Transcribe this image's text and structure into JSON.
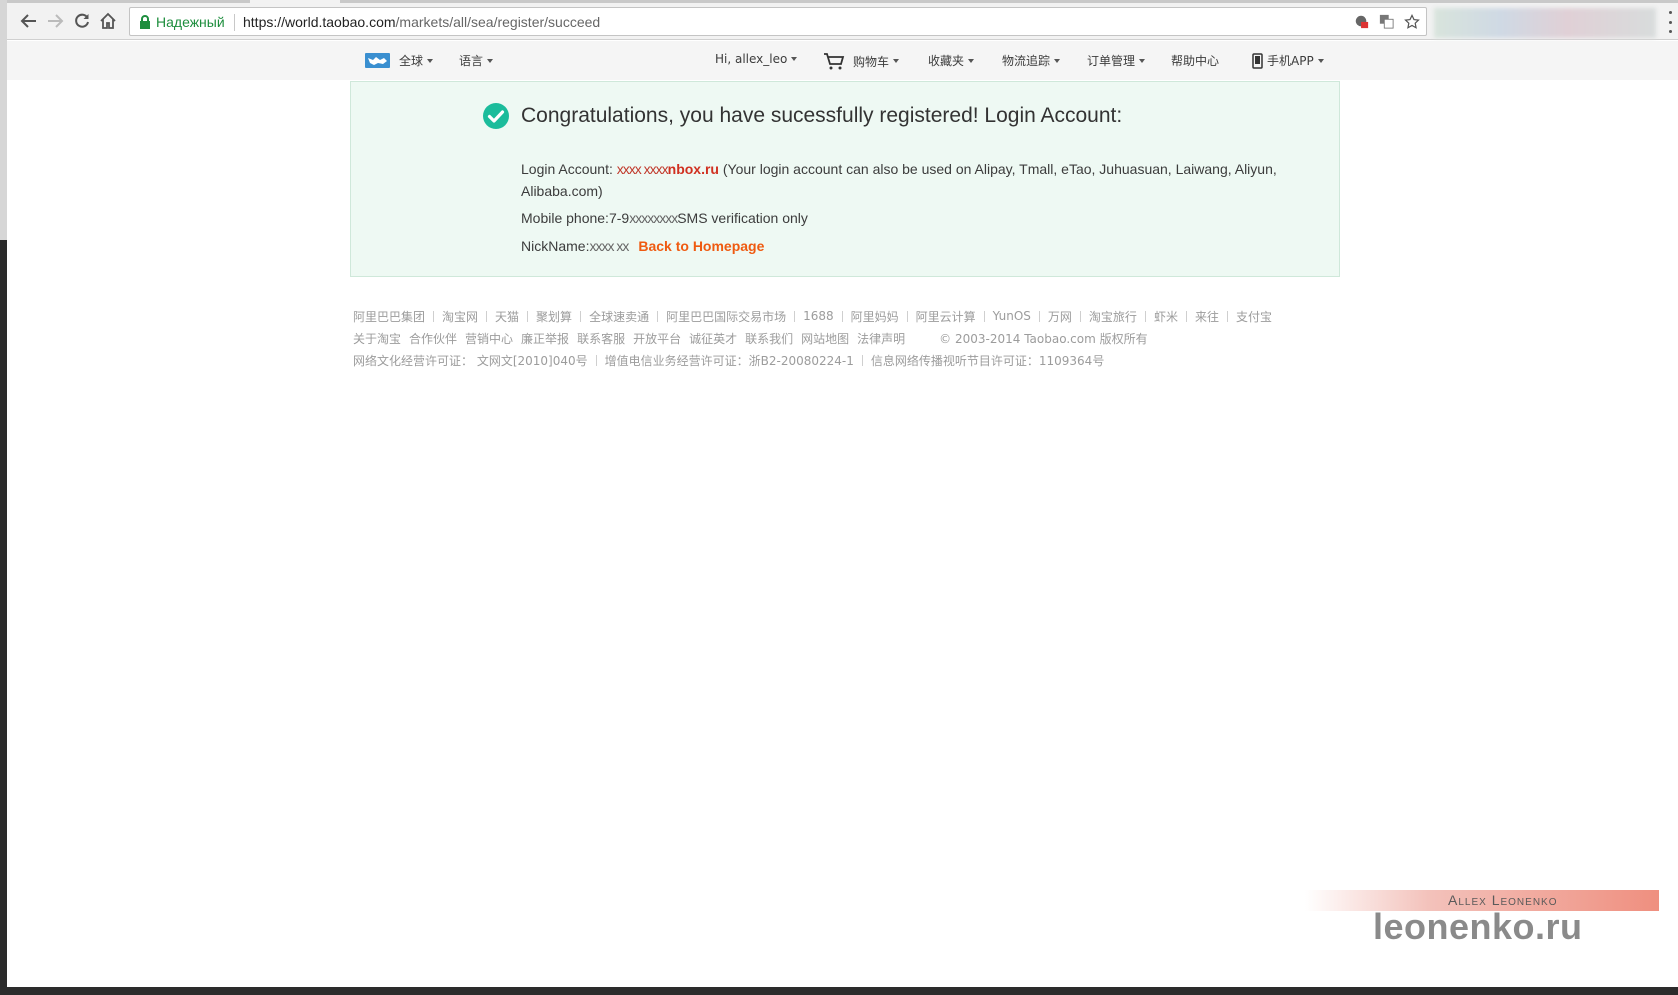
{
  "browser": {
    "secure_label": "Надежный",
    "url_host": "https://world.taobao.com",
    "url_path": "/markets/all/sea/register/succeed"
  },
  "site_nav": {
    "region": "全球",
    "language": "语言",
    "greeting": "Hi, allex_leo",
    "cart": "购物车",
    "favorites": "收藏夹",
    "logistics": "物流追踪",
    "orders": "订单管理",
    "help": "帮助中心",
    "mobile_app": "手机APP"
  },
  "success": {
    "title": "Congratulations, you have sucessfully registered! Login Account:",
    "login_label": "Login Account: ",
    "login_scribble": "xxxx xxxx",
    "login_domain": "nbox.ru",
    "login_note": " (Your login account can also be used on Alipay, Tmall, eTao, Juhuasuan, Laiwang, Aliyun, Alibaba.com)",
    "phone_label": "Mobile phone:7-9",
    "phone_scribble": "xxxxxxxx",
    "phone_note": "SMS verification only",
    "nick_label": "NickName:",
    "nick_scribble": "xxxx xx",
    "back_link": "Back to Homepage"
  },
  "footer": {
    "row1": [
      "阿里巴巴集团",
      "淘宝网",
      "天猫",
      "聚划算",
      "全球速卖通",
      "阿里巴巴国际交易市场",
      "1688",
      "阿里妈妈",
      "阿里云计算",
      "YunOS",
      "万网",
      "淘宝旅行",
      "虾米",
      "来往",
      "支付宝"
    ],
    "row2": [
      "关于淘宝",
      "合作伙伴",
      "营销中心",
      "廉正举报",
      "联系客服",
      "开放平台",
      "诚征英才",
      "联系我们",
      "网站地图",
      "法律声明"
    ],
    "copyright": "© 2003-2014 Taobao.com 版权所有",
    "row3": [
      "网络文化经营许可证：  文网文[2010]040号",
      "增值电信业务经营许可证：浙B2-20080224-1",
      "信息网络传播视听节目许可证：1109364号"
    ]
  },
  "watermark": {
    "name": "Allex Leonenko",
    "site": "leonenko.ru"
  },
  "colors": {
    "success_bg": "#eef9f3",
    "check": "#1bbc9b",
    "link_orange": "#ef5a10",
    "secure_green": "#1e8e3e"
  }
}
